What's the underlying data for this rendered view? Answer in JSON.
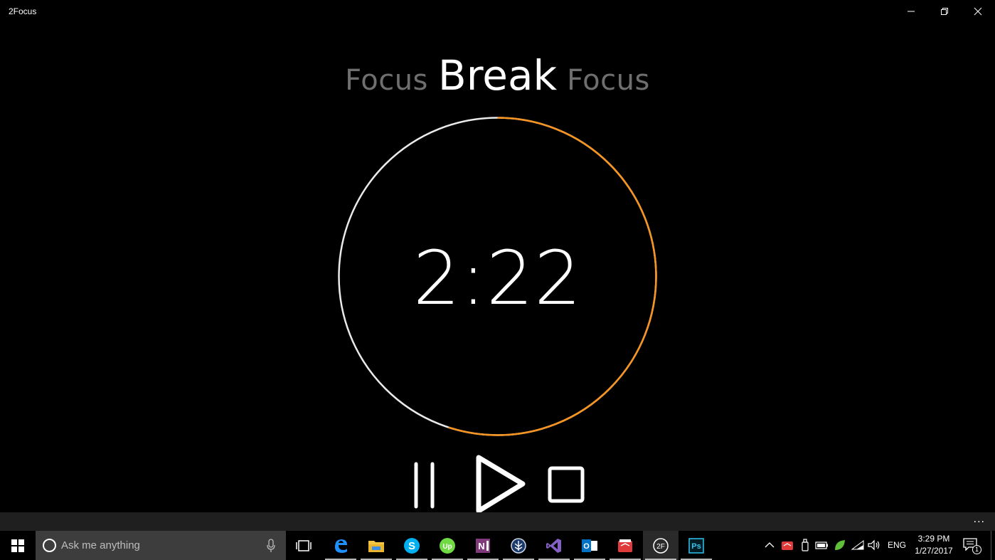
{
  "window": {
    "title": "2Focus"
  },
  "phases": {
    "previous": "Focus",
    "current": "Break",
    "next": "Focus"
  },
  "timer": {
    "display": "2:22",
    "elapsed_fraction": 0.45,
    "elapsed_color": "#e8eaec",
    "remaining_color": "#f7931e"
  },
  "appbar": {
    "more_label": "..."
  },
  "taskbar": {
    "search_placeholder": "Ask me anything",
    "language": "ENG",
    "time": "3:29 PM",
    "date": "1/27/2017",
    "notification_count": "1",
    "pinned_apps": [
      "edge",
      "file-explorer",
      "skype",
      "upwork",
      "onenote",
      "zapya",
      "visual-studio",
      "outlook",
      "wunderlist",
      "2focus",
      "photoshop"
    ]
  },
  "colors": {
    "accent": "#f7931e",
    "background": "#000000",
    "dim_text": "#6f6f6f"
  }
}
